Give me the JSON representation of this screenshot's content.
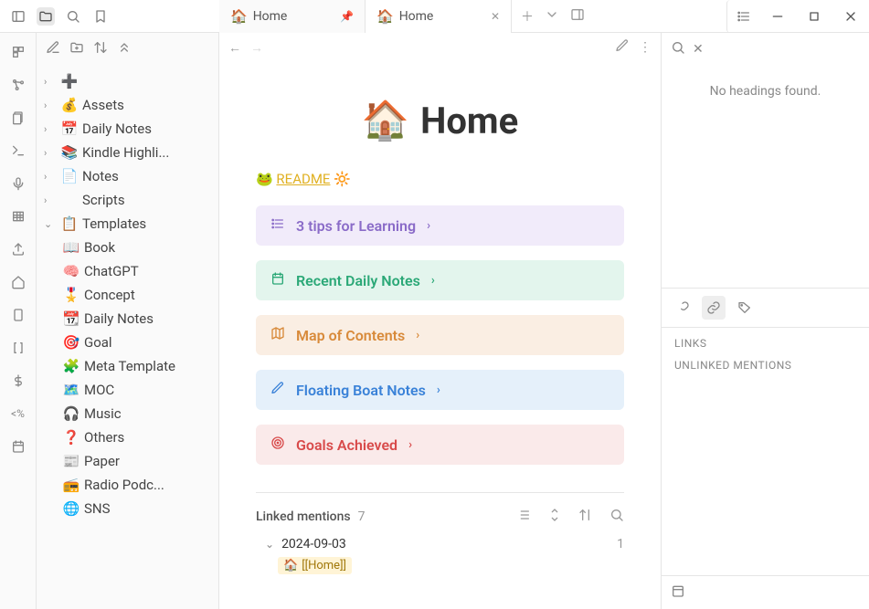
{
  "tabs": [
    {
      "emoji": "🏠",
      "label": "Home",
      "pinned": true
    },
    {
      "emoji": "🏠",
      "label": "Home",
      "active": true
    }
  ],
  "sidebar": {
    "folders": [
      {
        "emoji": "➕",
        "label": "",
        "chev": "›"
      },
      {
        "emoji": "💰",
        "label": "Assets",
        "chev": "›"
      },
      {
        "emoji": "📅",
        "label": "Daily Notes",
        "chev": "›"
      },
      {
        "emoji": "📚",
        "label": "Kindle Highli...",
        "chev": "›"
      },
      {
        "emoji": "📄",
        "label": "Notes",
        "chev": "›"
      },
      {
        "emoji": "</>",
        "label": "Scripts",
        "chev": "›",
        "code": true
      },
      {
        "emoji": "📋",
        "label": "Templates",
        "chev": "⌄",
        "expanded": true
      }
    ],
    "templates": [
      {
        "emoji": "📖",
        "label": "Book"
      },
      {
        "emoji": "🧠",
        "label": "ChatGPT"
      },
      {
        "emoji": "🎖️",
        "label": "Concept"
      },
      {
        "emoji": "📆",
        "label": "Daily Notes"
      },
      {
        "emoji": "🎯",
        "label": "Goal"
      },
      {
        "emoji": "🧩",
        "label": "Meta Template"
      },
      {
        "emoji": "🗺️",
        "label": "MOC"
      },
      {
        "emoji": "🎧",
        "label": "Music"
      },
      {
        "emoji": "❓",
        "label": "Others"
      },
      {
        "emoji": "📰",
        "label": "Paper"
      },
      {
        "emoji": "📻",
        "label": "Radio Podc..."
      },
      {
        "emoji": "🌐",
        "label": "SNS"
      }
    ]
  },
  "doc": {
    "emoji": "🏠",
    "title": "Home",
    "readme_prefix": "🐸",
    "readme_text": "README",
    "readme_suffix": "🔆",
    "callouts": [
      {
        "cls": "co-purple",
        "icon": "list",
        "label": "3 tips for Learning"
      },
      {
        "cls": "co-green",
        "icon": "calendar",
        "label": "Recent Daily Notes"
      },
      {
        "cls": "co-orange",
        "icon": "map",
        "label": "Map of Contents"
      },
      {
        "cls": "co-blue",
        "icon": "pencil",
        "label": "Floating Boat Notes"
      },
      {
        "cls": "co-red",
        "icon": "target",
        "label": "Goals Achieved"
      }
    ],
    "linked": {
      "title": "Linked mentions",
      "count": "7",
      "date": "2024-09-03",
      "date_count": "1",
      "ref_emoji": "🏠",
      "ref_text": "[[Home]]"
    }
  },
  "right": {
    "empty": "No headings found.",
    "links_label": "LINKS",
    "unlinked_label": "UNLINKED MENTIONS"
  }
}
